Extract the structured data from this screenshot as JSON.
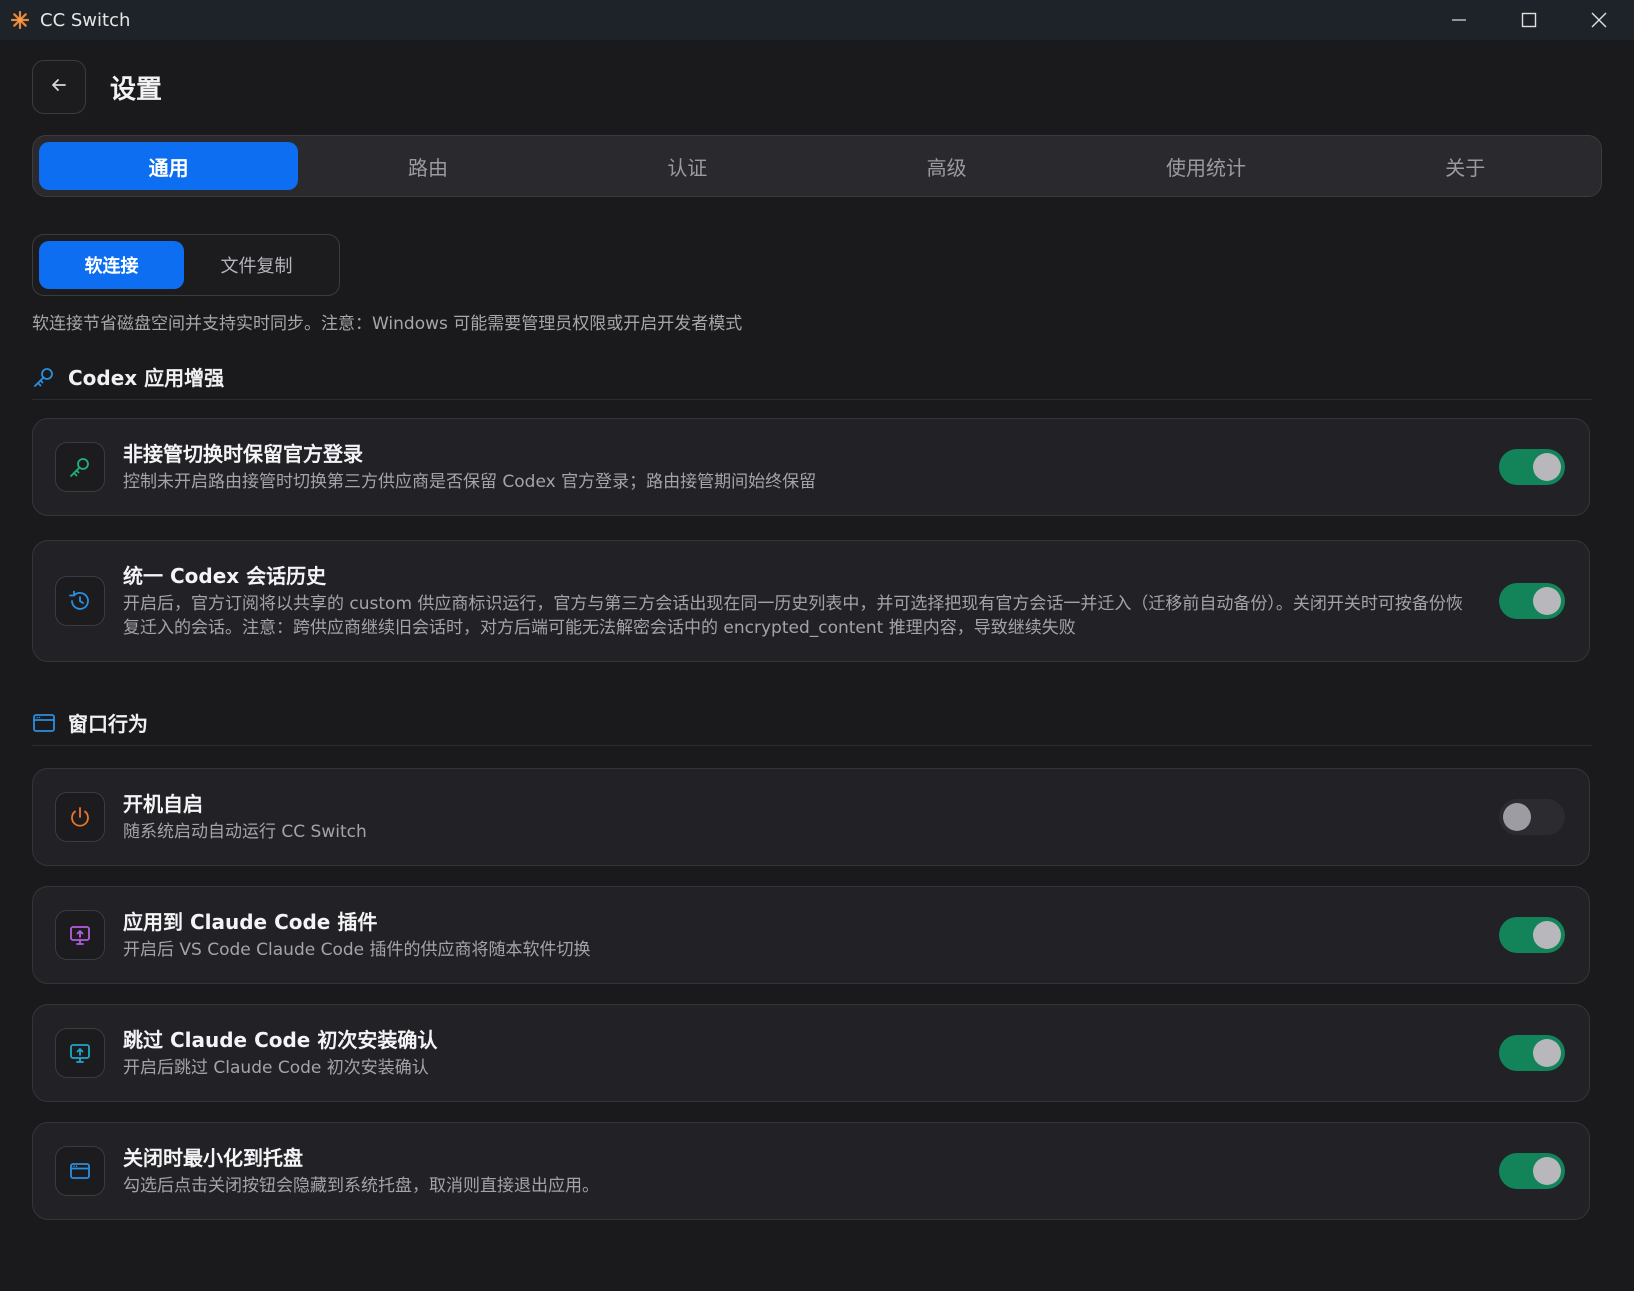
{
  "window": {
    "title": "CC Switch"
  },
  "header": {
    "title": "设置"
  },
  "tabs": [
    {
      "label": "通用",
      "active": true
    },
    {
      "label": "路由",
      "active": false
    },
    {
      "label": "认证",
      "active": false
    },
    {
      "label": "高级",
      "active": false
    },
    {
      "label": "使用统计",
      "active": false
    },
    {
      "label": "关于",
      "active": false
    }
  ],
  "mode": {
    "options": [
      {
        "label": "软连接",
        "active": true
      },
      {
        "label": "文件复制",
        "active": false
      }
    ],
    "description": "软连接节省磁盘空间并支持实时同步。注意：Windows 可能需要管理员权限或开启开发者模式"
  },
  "sections": {
    "codex": {
      "title": "Codex 应用增强",
      "icon": "key-icon",
      "items": [
        {
          "title": "非接管切换时保留官方登录",
          "description": "控制未开启路由接管时切换第三方供应商是否保留 Codex 官方登录；路由接管期间始终保留",
          "enabled": true,
          "icon": "key-icon",
          "icon_color": "#22b07a"
        },
        {
          "title": "统一 Codex 会话历史",
          "description": "开启后，官方订阅将以共享的 custom 供应商标识运行，官方与第三方会话出现在同一历史列表中，并可选择把现有官方会话一并迁入（迁移前自动备份）。关闭开关时可按备份恢复迁入的会话。注意：跨供应商继续旧会话时，对方后端可能无法解密会话中的 encrypted_content 推理内容，导致继续失败",
          "enabled": true,
          "icon": "history-icon",
          "icon_color": "#2b8fe0"
        }
      ]
    },
    "window": {
      "title": "窗口行为",
      "icon": "window-icon",
      "items": [
        {
          "title": "开机自启",
          "description": "随系统启动自动运行 CC Switch",
          "enabled": false,
          "icon": "power-icon",
          "icon_color": "#e8762b"
        },
        {
          "title": "应用到 Claude Code 插件",
          "description": "开启后 VS Code Claude Code 插件的供应商将随本软件切换",
          "enabled": true,
          "icon": "monitor-upload-icon",
          "icon_color": "#b45fe0"
        },
        {
          "title": "跳过 Claude Code 初次安装确认",
          "description": "开启后跳过 Claude Code 初次安装确认",
          "enabled": true,
          "icon": "monitor-upload-icon",
          "icon_color": "#1fa6c9"
        },
        {
          "title": "关闭时最小化到托盘",
          "description": "勾选后点击关闭按钮会隐藏到系统托盘，取消则直接退出应用。",
          "enabled": true,
          "icon": "window-icon",
          "icon_color": "#2b8fe0"
        }
      ]
    }
  },
  "colors": {
    "accent": "#0d6ef2",
    "toggle_on": "#13835a",
    "background": "#1a1a1c",
    "titlebar": "#1e2329"
  }
}
